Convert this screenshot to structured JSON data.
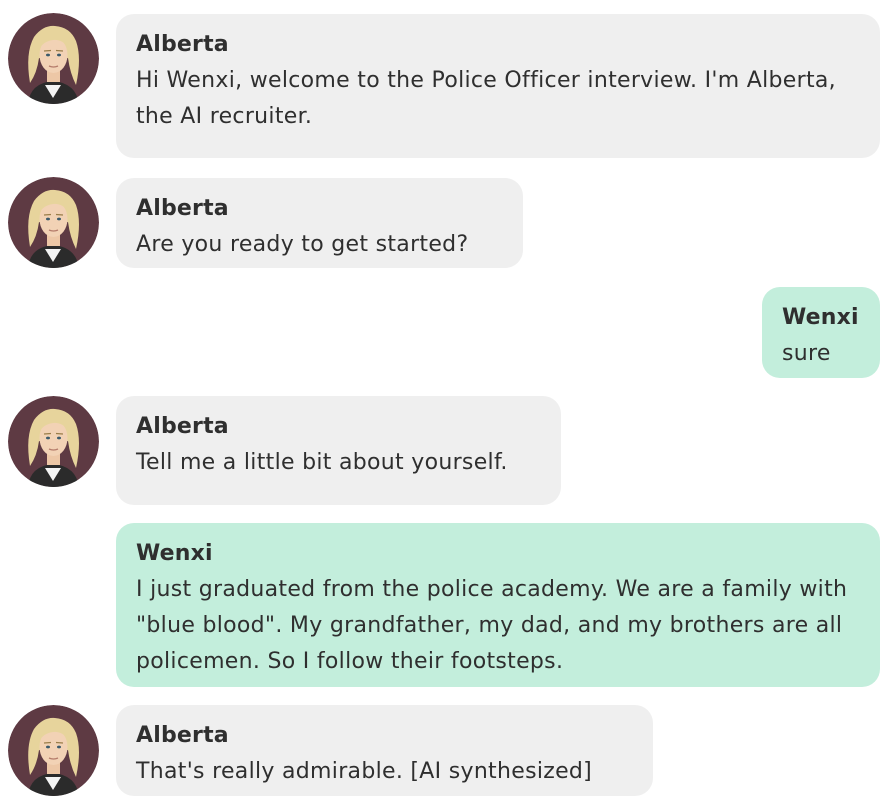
{
  "messages": [
    {
      "sender": "Alberta",
      "text": "Hi Wenxi, welcome to the Police Officer interview. I'm Alberta, the AI recruiter."
    },
    {
      "sender": "Alberta",
      "text": "Are you ready to get started?"
    },
    {
      "sender": "Wenxi",
      "text": "sure"
    },
    {
      "sender": "Alberta",
      "text": "Tell me a little bit about yourself."
    },
    {
      "sender": "Wenxi",
      "text": "I just graduated from the police academy. We are a family with \"blue blood\". My grandfather, my dad, and my brothers are all policemen. So I follow their footsteps."
    },
    {
      "sender": "Alberta",
      "text": "That's really admirable. [AI synthesized]"
    }
  ],
  "colors": {
    "bot_bubble": "#efefef",
    "user_bubble": "#c3eedc",
    "avatar_bg": "#5e3a43",
    "text": "#2f2f2f"
  },
  "icons": {
    "recruiter_avatar": "recruiter-avatar-icon"
  }
}
